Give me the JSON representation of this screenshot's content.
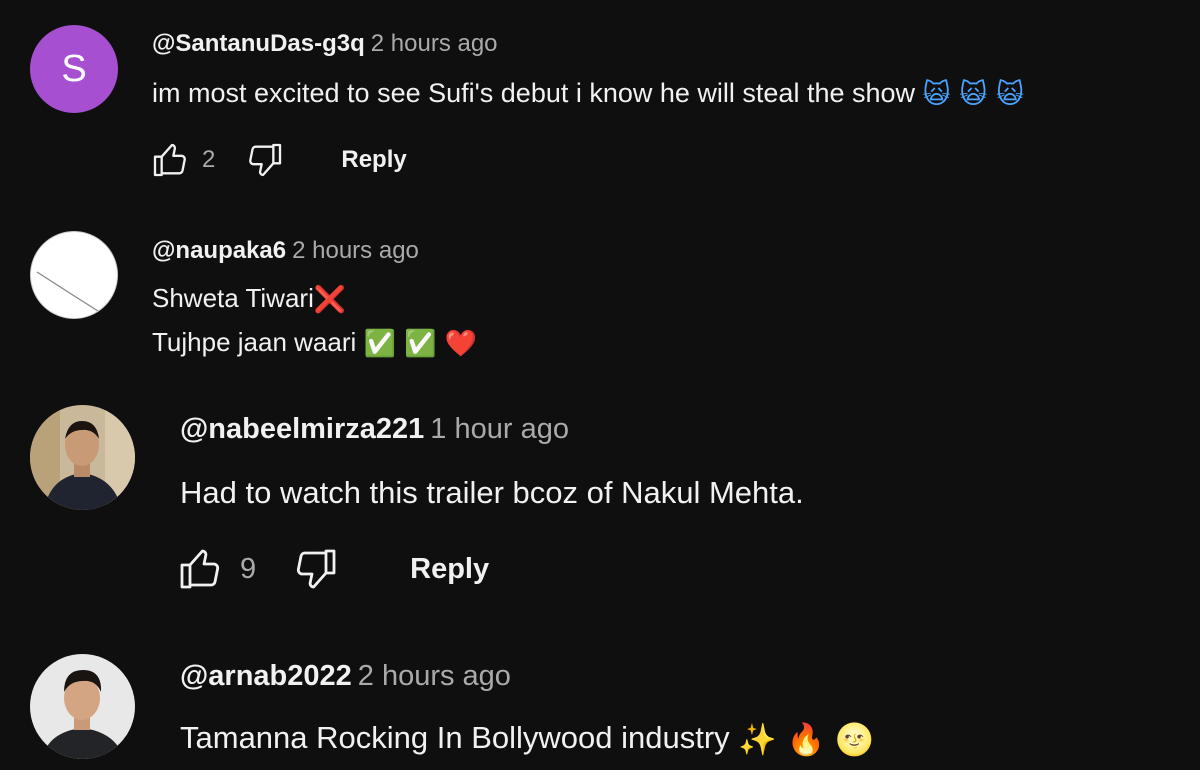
{
  "comments": [
    {
      "handle": "@SantanuDas-g3q",
      "time": "2 hours ago",
      "avatar_letter": "S",
      "avatar_color": "#a64fd1",
      "text": "im most excited to see Sufi's debut i know he will steal the show",
      "emojis": "🙀 🙀 🙀",
      "likes": "2",
      "reply_label": "Reply"
    },
    {
      "handle": "@naupaka6",
      "time": "2 hours ago",
      "line1": "Shweta Tiwari",
      "line1_emoji": "❌",
      "line2": "Tujhpe jaan waari",
      "line2_emojis": "✅ ✅ ❤️"
    },
    {
      "handle": "@nabeelmirza221",
      "time": "1 hour ago",
      "text": "Had to watch this trailer bcoz of Nakul Mehta.",
      "likes": "9",
      "reply_label": "Reply"
    },
    {
      "handle": "@arnab2022",
      "time": "2 hours ago",
      "text": "Tamanna Rocking In Bollywood industry",
      "emojis": "✨ 🔥 🌝"
    }
  ],
  "icons": {
    "like": "thumb-up-icon",
    "dislike": "thumb-down-icon"
  }
}
